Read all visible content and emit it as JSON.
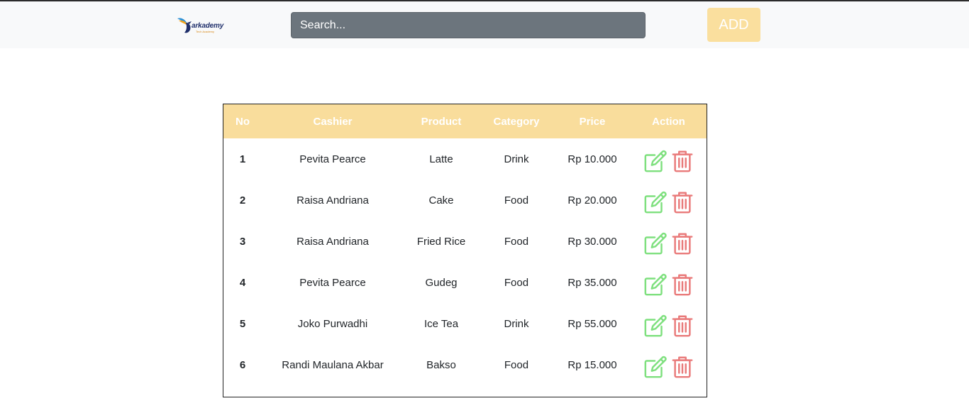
{
  "header": {
    "logo_text": "arkademy",
    "logo_subtext": "Tech Academy",
    "search_placeholder": "Search...",
    "add_label": "ADD"
  },
  "colors": {
    "header_bg": "#f8f9fa",
    "search_bg": "#6c757d",
    "accent": "#f9dd9c",
    "edit_icon": "#7ee07e",
    "delete_icon": "#e97a7a"
  },
  "table": {
    "columns": [
      "No",
      "Cashier",
      "Product",
      "Category",
      "Price",
      "Action"
    ],
    "rows": [
      {
        "no": "1",
        "cashier": "Pevita Pearce",
        "product": "Latte",
        "category": "Drink",
        "price": "Rp 10.000",
        "edit_icon": "edit-icon",
        "delete_icon": "trash-icon"
      },
      {
        "no": "2",
        "cashier": "Raisa Andriana",
        "product": "Cake",
        "category": "Food",
        "price": "Rp 20.000",
        "edit_icon": "edit-icon",
        "delete_icon": "trash-icon"
      },
      {
        "no": "3",
        "cashier": "Raisa Andriana",
        "product": "Fried Rice",
        "category": "Food",
        "price": "Rp 30.000",
        "edit_icon": "edit-icon",
        "delete_icon": "trash-icon"
      },
      {
        "no": "4",
        "cashier": "Pevita Pearce",
        "product": "Gudeg",
        "category": "Food",
        "price": "Rp 35.000",
        "edit_icon": "edit-icon",
        "delete_icon": "trash-icon"
      },
      {
        "no": "5",
        "cashier": "Joko Purwadhi",
        "product": "Ice Tea",
        "category": "Drink",
        "price": "Rp 55.000",
        "edit_icon": "edit-icon",
        "delete_icon": "trash-icon"
      },
      {
        "no": "6",
        "cashier": "Randi Maulana Akbar",
        "product": "Bakso",
        "category": "Food",
        "price": "Rp 15.000",
        "edit_icon": "edit-icon",
        "delete_icon": "trash-icon"
      }
    ]
  }
}
